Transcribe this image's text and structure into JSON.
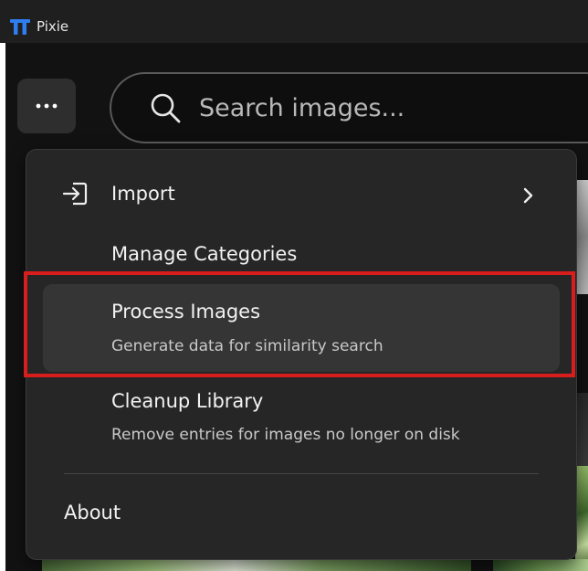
{
  "window": {
    "title": "Pixie"
  },
  "toolbar": {
    "more_label": "More options"
  },
  "search": {
    "placeholder": "Search images..."
  },
  "menu": {
    "items": [
      {
        "label": "Import",
        "has_submenu": true,
        "icon": "import-icon"
      },
      {
        "label": "Manage Categories"
      },
      {
        "label": "Process Images",
        "description": "Generate data for similarity search",
        "highlighted": true
      },
      {
        "label": "Cleanup Library",
        "description": "Remove entries for images no longer on disk"
      },
      {
        "label": "About"
      }
    ]
  },
  "colors": {
    "titlebar": "#1f1f1f",
    "app_background": "#121212",
    "menu_background": "#262626",
    "highlight": "#353535",
    "annotation_outline": "#d81d1d",
    "logo": "#2f7ef0"
  }
}
